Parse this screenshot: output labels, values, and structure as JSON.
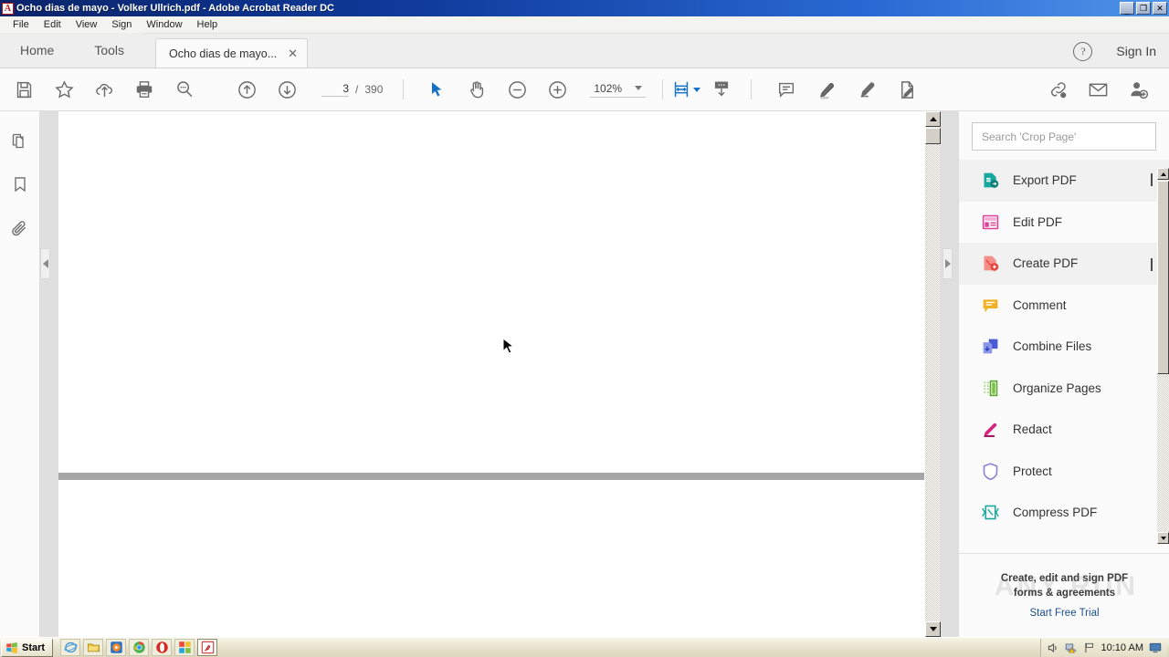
{
  "window": {
    "title": "Ocho dias de mayo - Volker Ullrich.pdf - Adobe Acrobat Reader DC",
    "app_icon": "acrobat-icon",
    "minimize": "_",
    "maximize": "❐",
    "close": "✕"
  },
  "menubar": {
    "items": [
      {
        "label": "File"
      },
      {
        "label": "Edit"
      },
      {
        "label": "View"
      },
      {
        "label": "Sign"
      },
      {
        "label": "Window"
      },
      {
        "label": "Help"
      }
    ]
  },
  "tabbar": {
    "home_label": "Home",
    "tools_label": "Tools",
    "document_tab": "Ocho dias de mayo...",
    "tab_close": "✕",
    "help_glyph": "?",
    "signin_label": "Sign In"
  },
  "toolbar": {
    "left_tools": [
      {
        "name": "save-file-icon",
        "title": "Save File"
      },
      {
        "name": "add-to-favorites-icon",
        "title": "Add to Favorites"
      },
      {
        "name": "upload-to-cloud-icon",
        "title": "Save to Document Cloud"
      },
      {
        "name": "print-file-icon",
        "title": "Print File"
      },
      {
        "name": "find-text-icon",
        "title": "Find"
      }
    ],
    "nav_tools": [
      {
        "name": "previous-page-icon",
        "title": "Previous Page"
      },
      {
        "name": "next-page-icon",
        "title": "Next Page"
      }
    ],
    "page_current": "3",
    "page_separator": "/",
    "page_total": "390",
    "cursor_tools": [
      {
        "name": "select-tool-icon",
        "title": "Select Tool",
        "active": true
      },
      {
        "name": "hand-tool-icon",
        "title": "Hand Tool",
        "active": false
      }
    ],
    "zoom_out": "zoom-out-icon",
    "zoom_in": "zoom-in-icon",
    "zoom_level": "102%",
    "view_tools": [
      {
        "name": "fit-page-icon",
        "title": "Fit Page",
        "active": true
      },
      {
        "name": "scroll-mode-icon",
        "title": "Scrolling Mode"
      }
    ],
    "annot_tools": [
      {
        "name": "add-comment-icon",
        "title": "Add Comment"
      },
      {
        "name": "highlight-text-icon",
        "title": "Highlight Text"
      },
      {
        "name": "draw-freehand-icon",
        "title": "Draw Free Form"
      },
      {
        "name": "fill-and-sign-icon",
        "title": "Fill & Sign"
      }
    ],
    "right_tools": [
      {
        "name": "share-link-icon",
        "title": "Share Link"
      },
      {
        "name": "send-email-icon",
        "title": "Send by Email"
      },
      {
        "name": "add-people-icon",
        "title": "Invite People"
      }
    ]
  },
  "leftrail": {
    "items": [
      {
        "name": "page-thumbnails-icon",
        "title": "Page Thumbnails"
      },
      {
        "name": "bookmarks-icon",
        "title": "Bookmarks"
      },
      {
        "name": "attachments-icon",
        "title": "Attachments"
      }
    ],
    "collapse_left": "◀",
    "collapse_right": "▶"
  },
  "rightpanel": {
    "search_placeholder": "Search 'Crop Page'",
    "search_value": "",
    "tools": [
      {
        "label": "Export PDF",
        "icon": "export-pdf-icon",
        "color": "#17a8a0",
        "chevron": "up",
        "selected": true
      },
      {
        "label": "Edit PDF",
        "icon": "edit-pdf-icon",
        "color": "#e0409a",
        "chevron": "",
        "selected": false
      },
      {
        "label": "Create PDF",
        "icon": "create-pdf-icon",
        "color": "#e8453c",
        "chevron": "down",
        "selected": true
      },
      {
        "label": "Comment",
        "icon": "comment-icon",
        "color": "#f0b323",
        "chevron": "",
        "selected": false
      },
      {
        "label": "Combine Files",
        "icon": "combine-files-icon",
        "color": "#4a5ad4",
        "chevron": "",
        "selected": false
      },
      {
        "label": "Organize Pages",
        "icon": "organize-pages-icon",
        "color": "#76c043",
        "chevron": "",
        "selected": false
      },
      {
        "label": "Redact",
        "icon": "redact-icon",
        "color": "#d4267f",
        "chevron": "",
        "selected": false
      },
      {
        "label": "Protect",
        "icon": "protect-icon",
        "color": "#8b7fd4",
        "chevron": "",
        "selected": false
      },
      {
        "label": "Compress PDF",
        "icon": "compress-pdf-icon",
        "color": "#17a8a0",
        "chevron": "",
        "selected": false
      }
    ],
    "promo_line1": "Create, edit and sign PDF",
    "promo_line2": "forms & agreements",
    "promo_link": "Start Free Trial",
    "watermark": "ANY RUN"
  },
  "taskbar": {
    "start_label": "Start",
    "quick_launch": [
      {
        "name": "internet-explorer-icon",
        "color": "#4a9fd8"
      },
      {
        "name": "file-explorer-icon",
        "color": "#e8c23a"
      },
      {
        "name": "media-player-icon",
        "color": "#f08a24"
      },
      {
        "name": "google-chrome-icon",
        "color": "#4285f4"
      },
      {
        "name": "opera-browser-icon",
        "color": "#d9281f"
      },
      {
        "name": "applications-icon",
        "color": "#c0392b"
      },
      {
        "name": "adobe-reader-icon",
        "color": "#c01a1a"
      }
    ],
    "tray": [
      {
        "name": "volume-icon"
      },
      {
        "name": "network-warning-icon"
      },
      {
        "name": "flag-icon"
      }
    ],
    "clock": "10:10 AM"
  }
}
